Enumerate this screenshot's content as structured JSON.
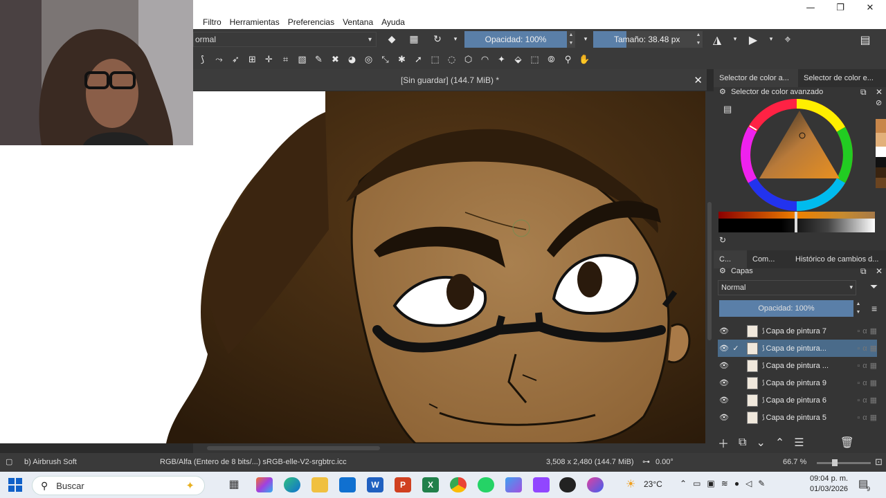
{
  "window": {
    "title_bar_buttons": [
      "minimize-icon",
      "restore-icon",
      "close-icon"
    ]
  },
  "menu": {
    "items": [
      "Filtro",
      "Herramientas",
      "Preferencias",
      "Ventana",
      "Ayuda"
    ]
  },
  "toolbar": {
    "blend_mode": "ormal",
    "opacity_label": "Opacidad: 100%",
    "opacity_value": 1.0,
    "size_label": "Tamaño: 38.48 px",
    "size_value": 38.48
  },
  "document": {
    "tab_title": "[Sin guardar]  (144.7 MiB) *"
  },
  "docker": {
    "tabs_top": [
      "Selector de color a...",
      "Selector de color e..."
    ],
    "color_selector_title": "Selector de color avanzado",
    "tabs_mid": [
      "C...",
      "Com...",
      "Histórico de cambios d..."
    ],
    "layers_title": "Capas",
    "layers_blend": "Normal",
    "layers_opacity": "Opacidad:  100%",
    "layers": [
      {
        "name": "Capa de pintura 7",
        "selected": false,
        "checked": false
      },
      {
        "name": "Capa de pintura...",
        "selected": true,
        "checked": true
      },
      {
        "name": "Capa de pintura ...",
        "selected": false,
        "checked": false
      },
      {
        "name": "Capa de pintura 9",
        "selected": false,
        "checked": false
      },
      {
        "name": "Capa de pintura 6",
        "selected": false,
        "checked": false
      },
      {
        "name": "Capa de pintura 5",
        "selected": false,
        "checked": false
      }
    ]
  },
  "status": {
    "brush": "b) Airbrush Soft",
    "color_space": "RGB/Alfa (Entero de 8 bits/...)  sRGB-elle-V2-srgbtrc.icc",
    "dimensions": "3,508 x 2,480 (144.7 MiB)",
    "rotation": "0.00°",
    "zoom": "66.7 %"
  },
  "taskbar": {
    "search_placeholder": "Buscar",
    "weather": "23°C",
    "time": "09:04 p. m.",
    "date": "01/03/2026",
    "notification_count": "9"
  },
  "colors": {
    "accent": "#5a7fa8",
    "skin": "#a97a48",
    "hair": "#3a2410"
  }
}
